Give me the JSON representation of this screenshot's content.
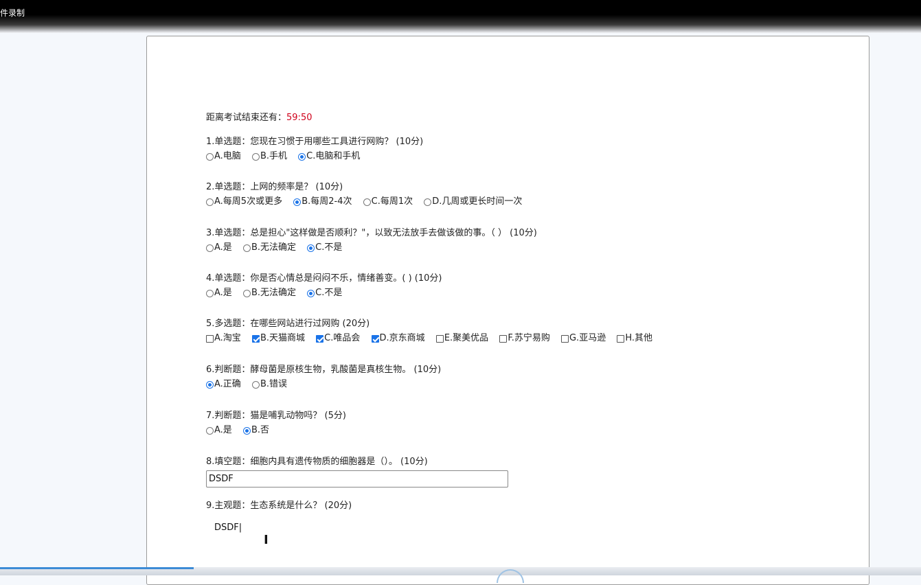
{
  "window": {
    "title": "件录制"
  },
  "timer": {
    "label": "距离考试结束还有：",
    "remaining": "59:50",
    "color": "#d0021b"
  },
  "questions": [
    {
      "title": "1.单选题：您现在习惯于用哪些工具进行网购？ (10分)",
      "options": [
        {
          "label": "A.电脑",
          "selected": false
        },
        {
          "label": "B.手机",
          "selected": false
        },
        {
          "label": "C.电脑和手机",
          "selected": true
        }
      ]
    },
    {
      "title": "2.单选题：上网的频率是？ (10分)",
      "options": [
        {
          "label": "A.每周5次或更多",
          "selected": false
        },
        {
          "label": "B.每周2-4次",
          "selected": true
        },
        {
          "label": "C.每周1次",
          "selected": false
        },
        {
          "label": "D.几周或更长时间一次",
          "selected": false
        }
      ]
    },
    {
      "title": "3.单选题：总是担心\"这样做是否顺利？\"，以致无法放手去做该做的事。（ ） (10分)",
      "options": [
        {
          "label": "A.是",
          "selected": false
        },
        {
          "label": "B.无法确定",
          "selected": false
        },
        {
          "label": "C.不是",
          "selected": true
        }
      ]
    },
    {
      "title": "4.单选题：你是否心情总是闷闷不乐，情绪善变。( ) (10分)",
      "options": [
        {
          "label": "A.是",
          "selected": false
        },
        {
          "label": "B.无法确定",
          "selected": false
        },
        {
          "label": "C.不是",
          "selected": true
        }
      ]
    },
    {
      "title": "5.多选题：在哪些网站进行过网购 (20分)",
      "options": [
        {
          "label": "A.淘宝",
          "selected": false
        },
        {
          "label": "B.天猫商城",
          "selected": true
        },
        {
          "label": "C.唯品会",
          "selected": true
        },
        {
          "label": "D.京东商城",
          "selected": true
        },
        {
          "label": "E.聚美优品",
          "selected": false
        },
        {
          "label": "F.苏宁易购",
          "selected": false
        },
        {
          "label": "G.亚马逊",
          "selected": false
        },
        {
          "label": "H.其他",
          "selected": false
        }
      ]
    },
    {
      "title": "6.判断题：酵母菌是原核生物，乳酸菌是真核生物。 (10分)",
      "options": [
        {
          "label": "A.正确",
          "selected": true
        },
        {
          "label": "B.错误",
          "selected": false
        }
      ]
    },
    {
      "title": "7.判断题：猫是哺乳动物吗？ (5分)",
      "options": [
        {
          "label": "A.是",
          "selected": false
        },
        {
          "label": "B.否",
          "selected": true
        }
      ]
    },
    {
      "title": "8.填空题：细胞内具有遗传物质的细胞器是（）。 (10分)",
      "value": "DSDF"
    },
    {
      "title": "9.主观题：生态系统是什么？ (20分)",
      "value": "DSDF"
    }
  ],
  "player": {
    "progress": 0.21
  }
}
